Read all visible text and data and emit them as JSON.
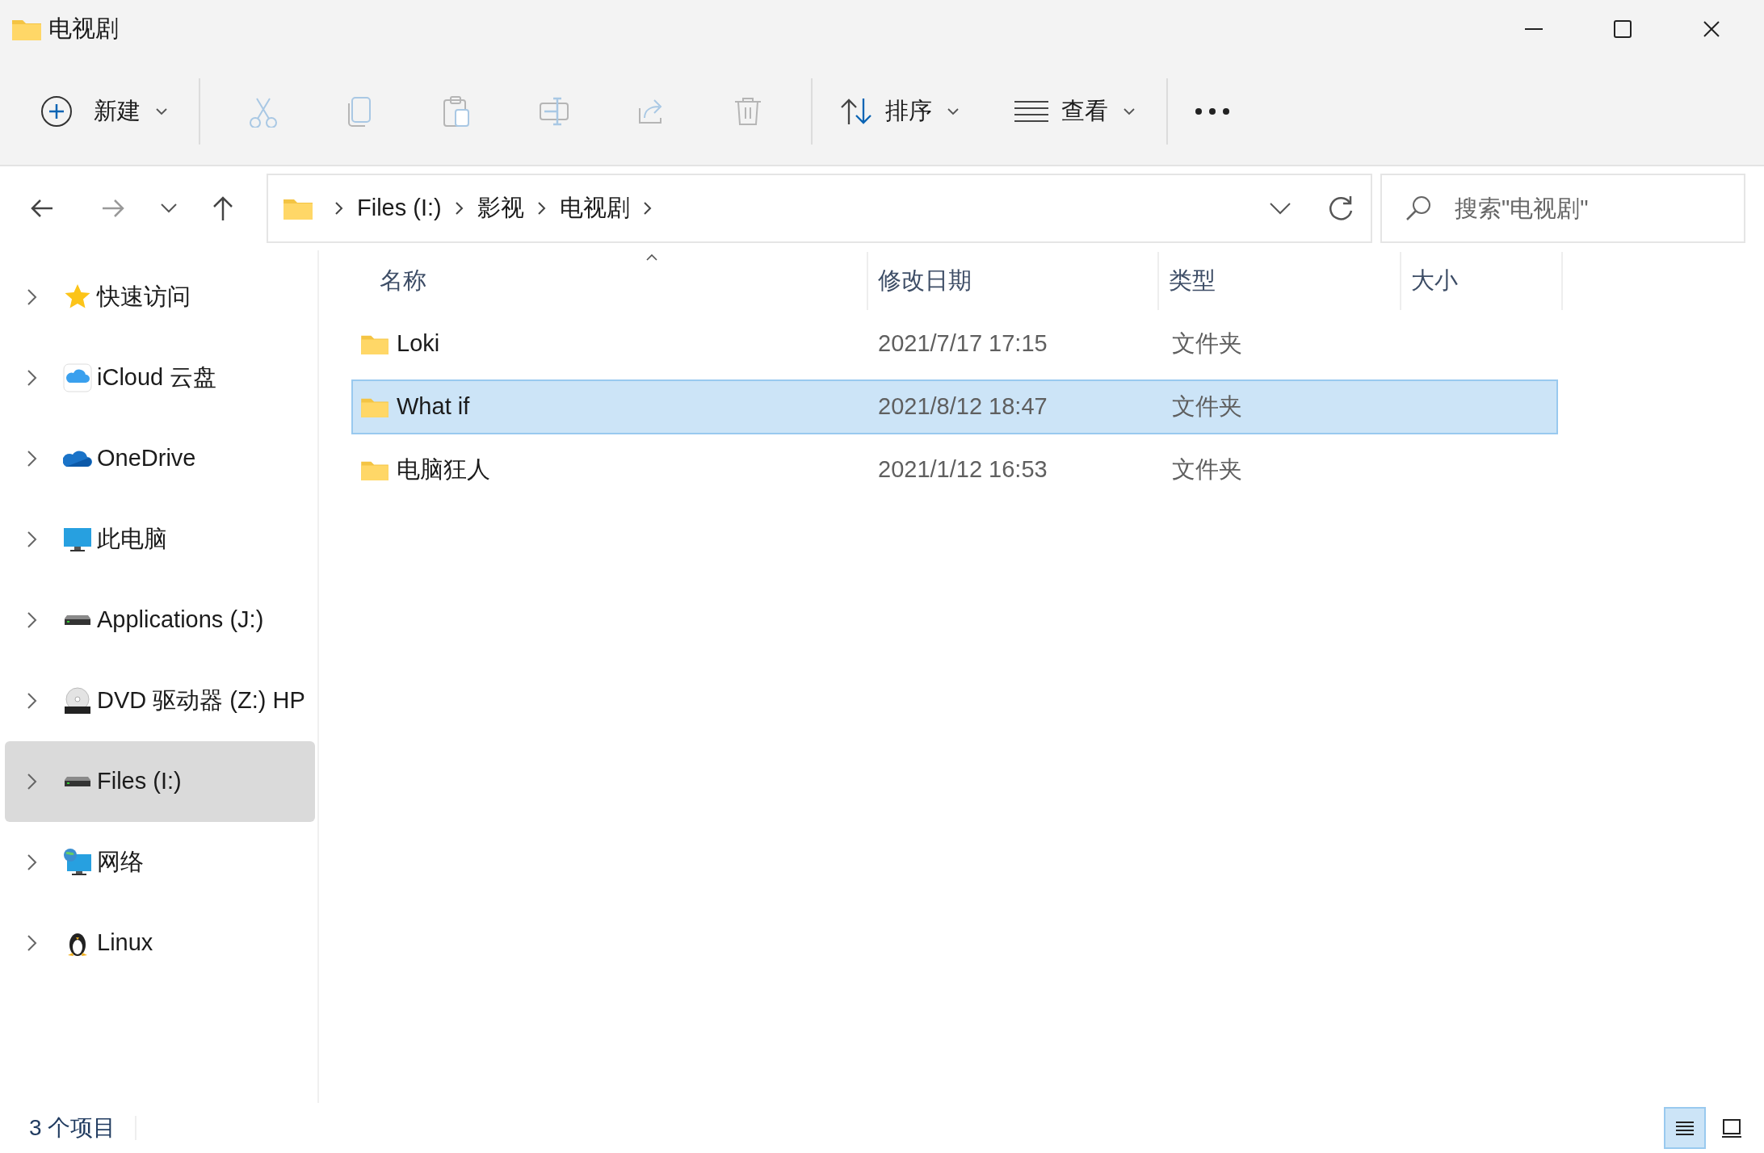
{
  "window": {
    "title": "电视剧"
  },
  "toolbar": {
    "new_button": {
      "label": "新建"
    },
    "actions": [
      {
        "kind": "cut",
        "disabled": true
      },
      {
        "kind": "copy",
        "disabled": true
      },
      {
        "kind": "paste",
        "disabled": true
      },
      {
        "kind": "rename",
        "disabled": true
      },
      {
        "kind": "share",
        "disabled": true
      },
      {
        "kind": "delete",
        "disabled": true
      }
    ],
    "sort_button": {
      "label": "排序"
    },
    "view_button": {
      "label": "查看"
    }
  },
  "address_bar": {
    "breadcrumbs": [
      "Files (I:)",
      "影视",
      "电视剧"
    ]
  },
  "search": {
    "placeholder": "搜索\"电视剧\""
  },
  "sidebar": {
    "items": [
      {
        "label": "快速访问",
        "kind": "star",
        "expanded": false,
        "selected": false
      },
      {
        "label": "iCloud 云盘",
        "kind": "icloud",
        "expanded": false,
        "selected": false
      },
      {
        "label": "OneDrive",
        "kind": "cloud",
        "expanded": false,
        "selected": false
      },
      {
        "label": "此电脑",
        "kind": "monitor",
        "expanded": false,
        "selected": false
      },
      {
        "label": "Applications (J:)",
        "kind": "drive",
        "expanded": false,
        "selected": false
      },
      {
        "label": "DVD 驱动器 (Z:) HP",
        "kind": "dvd",
        "expanded": false,
        "selected": false
      },
      {
        "label": "Files (I:)",
        "kind": "drive",
        "expanded": false,
        "selected": true
      },
      {
        "label": "网络",
        "kind": "network",
        "expanded": false,
        "selected": false
      },
      {
        "label": "Linux",
        "kind": "penguin",
        "expanded": false,
        "selected": false
      }
    ]
  },
  "file_list": {
    "columns": [
      {
        "label": "名称",
        "sorted": true
      },
      {
        "label": "修改日期",
        "sorted": false
      },
      {
        "label": "类型",
        "sorted": false
      },
      {
        "label": "大小",
        "sorted": false
      }
    ],
    "rows": [
      {
        "name": "Loki",
        "modified": "2021/7/17 17:15",
        "type": "文件夹",
        "selected": false
      },
      {
        "name": "What if",
        "modified": "2021/8/12 18:47",
        "type": "文件夹",
        "selected": true
      },
      {
        "name": "电脑狂人",
        "modified": "2021/1/12 16:53",
        "type": "文件夹",
        "selected": false
      }
    ]
  },
  "status_bar": {
    "item_count": "3 个项目",
    "view_modes": [
      {
        "kind": "details",
        "selected": true
      },
      {
        "kind": "tiles",
        "selected": false
      }
    ]
  }
}
